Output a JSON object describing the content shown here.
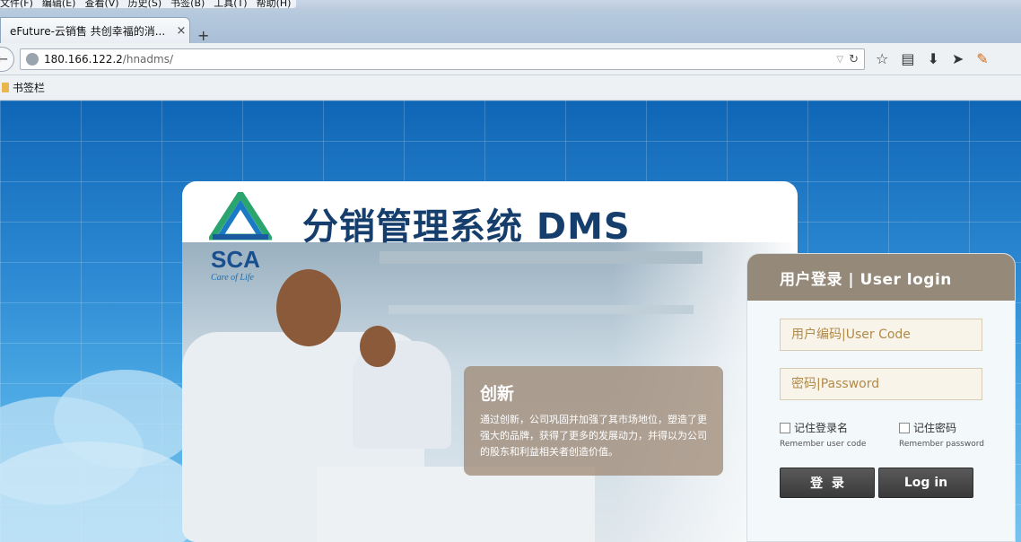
{
  "browser": {
    "menu_items": [
      "文件(F)",
      "编辑(E)",
      "查看(V)",
      "历史(S)",
      "书签(B)",
      "工具(T)",
      "帮助(H)"
    ],
    "tab_title": "eFuture-云销售 共创幸福的消...",
    "tab_close": "×",
    "new_tab": "+",
    "url_host": "180.166.122.2",
    "url_path": "/hnadms/",
    "bookmarks_folder": "书签栏"
  },
  "brand": {
    "logo_text": "SCA",
    "logo_tagline": "Care of Life",
    "system_name": "分销管理系统  DMS"
  },
  "banner": {
    "heading": "创新",
    "text": "通过创新，公司巩固并加强了其市场地位，塑造了更强大的品牌，获得了更多的发展动力，并得以为公司的股东和利益相关者创造价值。"
  },
  "login": {
    "title": "用户登录 | User login",
    "user_code_placeholder": "用户编码|User Code",
    "password_placeholder": "密码|Password",
    "remember_user_label": "记住登录名",
    "remember_user_sub": "Remember user code",
    "remember_password_label": "记住密码",
    "remember_password_sub": "Remember password",
    "login_cn_button": "登  录",
    "login_en_button": "Log in"
  },
  "colors": {
    "accent_dark_blue": "#163e6c",
    "login_header": "#958a79",
    "background_blue": "#1b78c2"
  }
}
